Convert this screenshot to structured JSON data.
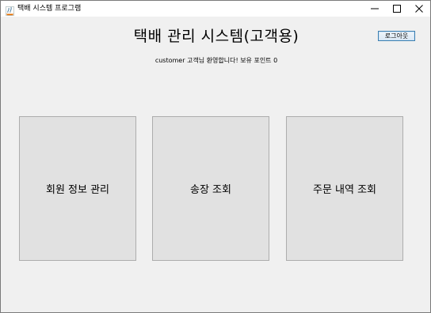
{
  "window": {
    "title": "택배 시스템 프로그램",
    "icons": [
      "java-app-icon",
      "minimize-icon",
      "maximize-icon",
      "close-icon"
    ]
  },
  "header": {
    "title": "택배 관리 시스템(고객용)",
    "welcome": "customer 고객님 환영합니다! 보유 포인트 0",
    "logout_label": "로그아웃"
  },
  "menu": {
    "items": [
      {
        "label": "회원 정보 관리"
      },
      {
        "label": "송장 조회"
      },
      {
        "label": "주문 내역 조회"
      }
    ]
  },
  "colors": {
    "background": "#f0f0f0",
    "tile": "#e1e1e1",
    "button_border": "#3c7fb1"
  }
}
